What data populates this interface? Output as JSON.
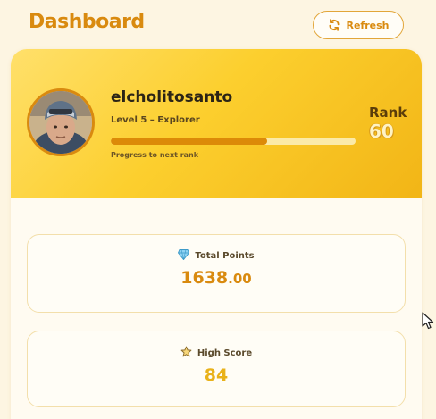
{
  "header": {
    "title": "Dashboard",
    "refresh_label": "Refresh"
  },
  "profile": {
    "username": "elcholitosanto",
    "level_text": "Level 5 – Explorer",
    "progress_caption": "Progress to next rank",
    "progress_fraction": 0.64,
    "rank_label": "Rank",
    "rank_value": "60"
  },
  "stats": {
    "total_points": {
      "label": "Total Points",
      "value_int": "1638",
      "value_dec": ".00",
      "icon": "gem-icon"
    },
    "high_score": {
      "label": "High Score",
      "value": "84",
      "icon": "star-icon"
    }
  },
  "colors": {
    "accent": "#d98a0f",
    "banner_start": "#ffe06b",
    "banner_end": "#f2b516",
    "background": "#fdf5e2"
  }
}
